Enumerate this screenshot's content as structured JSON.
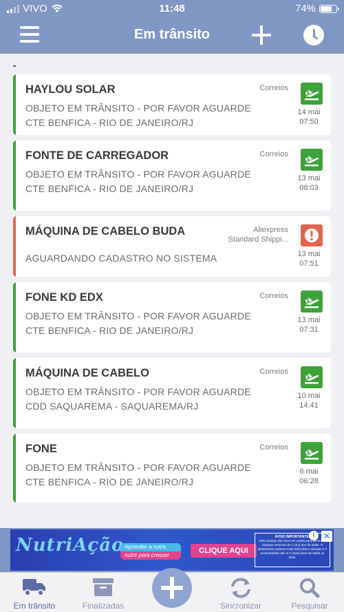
{
  "status_bar": {
    "carrier": "VIVO",
    "time": "11:48",
    "battery": "74%",
    "battery_level": 0.74
  },
  "header": {
    "title": "Em trânsito"
  },
  "colors": {
    "accent": "#7f97c4",
    "ok": "#3da23a",
    "error": "#e2664e"
  },
  "packages": [
    {
      "name": "HAYLOU SOLAR",
      "carrier": "Correios",
      "status_line1": "OBJETO EM TRÂNSITO - POR FAVOR AGUARDE",
      "status_line2": "CTE BENFICA - RIO DE JANEIRO/RJ",
      "date": "14 mai",
      "time": "07:50",
      "state": "transit",
      "icon": "plane-icon"
    },
    {
      "name": "FONTE DE CARREGADOR",
      "carrier": "Correios",
      "status_line1": "OBJETO EM TRÂNSITO - POR FAVOR AGUARDE",
      "status_line2": "CTE BENFICA - RIO DE JANEIRO/RJ",
      "date": "13 mai",
      "time": "08:03",
      "state": "transit",
      "icon": "plane-icon"
    },
    {
      "name": "MÁQUINA DE CABELO BUDA",
      "carrier": "Aliexpress",
      "carrier_line2": "Standard Shippi...",
      "status_line1": "AGUARDANDO CADASTRO NO SISTEMA",
      "status_line2": "",
      "date": "13 mai",
      "time": "07:51",
      "state": "error",
      "icon": "alert-icon"
    },
    {
      "name": "FONE KD EDX",
      "carrier": "Correios",
      "status_line1": "OBJETO EM TRÂNSITO - POR FAVOR AGUARDE",
      "status_line2": "CTE BENFICA - RIO DE JANEIRO/RJ",
      "date": "13 mai",
      "time": "07:31",
      "state": "transit",
      "icon": "plane-icon"
    },
    {
      "name": "MÁQUINA DE CABELO",
      "carrier": "Correios",
      "status_line1": "OBJETO EM TRÂNSITO - POR FAVOR AGUARDE",
      "status_line2": "CDD SAQUAREMA - SAQUAREMA/RJ",
      "date": "10 mai",
      "time": "14:41",
      "state": "transit",
      "icon": "plane-icon"
    },
    {
      "name": "FONE",
      "carrier": "Correios",
      "status_line1": "OBJETO EM TRÂNSITO - POR FAVOR AGUARDE",
      "status_line2": "CTE BENFICA - RIO DE JANEIRO/RJ",
      "date": "6 mai",
      "time": "06:28",
      "state": "transit",
      "icon": "plane-icon"
    }
  ],
  "ad": {
    "brand": "NutriAção",
    "tagline1": "Aprender a nutrir,",
    "tagline2": "nutrir para crescer",
    "cta": "CLIQUE AQUI",
    "notice_title": "AVISO IMPORTANTE:",
    "notice_text": "Este produto não deve ser usado para alimentar crianças menores de 1 (um) ano de idade. O aleitamento materno evita infecções e alergias e é recomendado até os 2 (dois) anos de idade ou mais."
  },
  "tabbar": {
    "tabs": [
      {
        "label": "Em trânsito",
        "icon": "truck-icon",
        "active": true
      },
      {
        "label": "Finalizadas",
        "icon": "archive-icon",
        "active": false
      },
      {
        "label": "Sincronizar",
        "icon": "sync-icon",
        "active": false
      },
      {
        "label": "Pesquisar",
        "icon": "search-icon",
        "active": false
      }
    ]
  }
}
